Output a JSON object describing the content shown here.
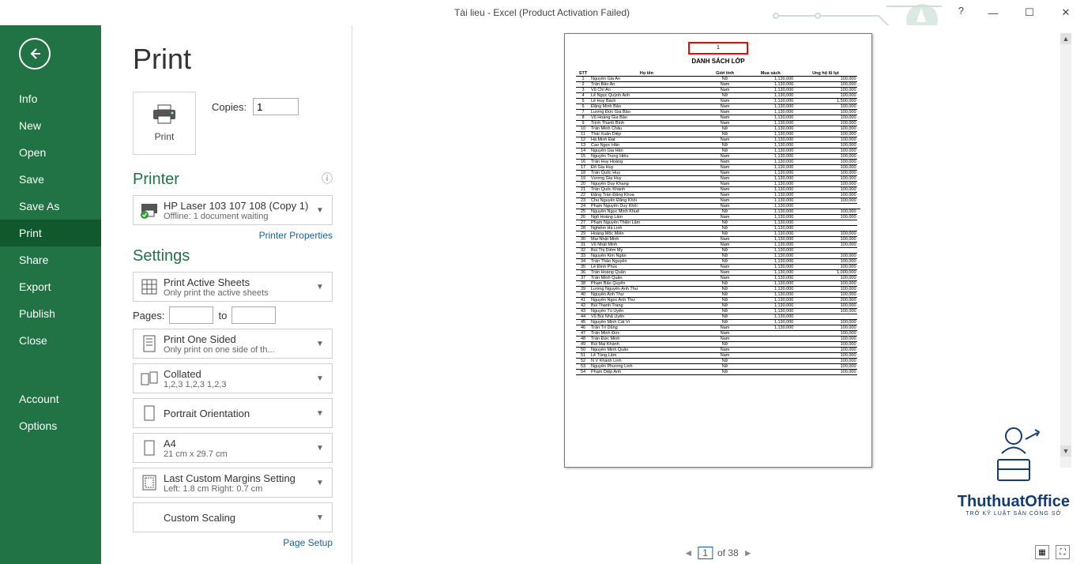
{
  "titlebar": {
    "title": "Tài lieu - Excel (Product Activation Failed)",
    "help": "?"
  },
  "sidebar": {
    "items": [
      "Info",
      "New",
      "Open",
      "Save",
      "Save As",
      "Print",
      "Share",
      "Export",
      "Publish",
      "Close",
      "Account",
      "Options"
    ],
    "selected": "Print"
  },
  "page": {
    "title": "Print",
    "print_button": "Print",
    "copies_label": "Copies:",
    "copies_value": "1"
  },
  "printer": {
    "heading": "Printer",
    "name": "HP Laser 103 107 108 (Copy 1)",
    "status": "Offline: 1 document waiting",
    "properties_link": "Printer Properties"
  },
  "settings": {
    "heading": "Settings",
    "scope": {
      "main": "Print Active Sheets",
      "sub": "Only print the active sheets"
    },
    "pages": {
      "label": "Pages:",
      "to": "to"
    },
    "sides": {
      "main": "Print One Sided",
      "sub": "Only print on one side of th..."
    },
    "collate": {
      "main": "Collated",
      "sub": "1,2,3    1,2,3    1,2,3"
    },
    "orientation": {
      "main": "Portrait Orientation"
    },
    "paper": {
      "main": "A4",
      "sub": "21 cm x 29.7 cm"
    },
    "margins": {
      "main": "Last Custom Margins Setting",
      "sub": "Left:   1.8 cm     Right:   0.7 cm"
    },
    "scaling": {
      "main": "Custom Scaling"
    },
    "page_setup_link": "Page Setup"
  },
  "pager": {
    "current": "1",
    "of": "of 38"
  },
  "preview": {
    "header_number": "1",
    "title": "DANH SÁCH LỚP",
    "columns": [
      "STT",
      "Họ tên",
      "Giới tính",
      "Mua sách",
      "Úng hộ lũ lụt"
    ],
    "rows": [
      [
        "1",
        "Nguyễn Gia An",
        "Nữ",
        "1,130,000",
        "100,000"
      ],
      [
        "2",
        "Trần Bảo An",
        "Nam",
        "1,130,000",
        "100,000"
      ],
      [
        "3",
        "Vũ Chí An",
        "Nam",
        "1,130,000",
        "100,000"
      ],
      [
        "4",
        "Lê Ngọc Quỳnh Anh",
        "Nữ",
        "1,130,000",
        "100,000"
      ],
      [
        "5",
        "Lê Huy Bách",
        "Nam",
        "1,130,000",
        "1,500,000"
      ],
      [
        "6",
        "Đặng Minh Bảo",
        "Nam",
        "1,130,000",
        "100,000"
      ],
      [
        "7",
        "Lương Đức Gia Bảo",
        "Nam",
        "1,130,000",
        "100,000"
      ],
      [
        "8",
        "Vũ Hoàng Gia Bảo",
        "Nam",
        "1,130,000",
        "100,000"
      ],
      [
        "9",
        "Trịnh Thanh Bình",
        "Nam",
        "1,130,000",
        "100,000"
      ],
      [
        "10",
        "Trần Minh Châu",
        "Nữ",
        "1,130,000",
        "100,000"
      ],
      [
        "11",
        "Thái Xuân Diệp",
        "Nữ",
        "1,130,000",
        "100,000"
      ],
      [
        "12",
        "Hà Minh Đạt",
        "Nam",
        "1,130,000",
        "100,000"
      ],
      [
        "13",
        "Cao Ngọc Hân",
        "Nữ",
        "1,130,000",
        "100,000"
      ],
      [
        "14",
        "Nguyễn Gia Hân",
        "Nữ",
        "1,130,000",
        "100,000"
      ],
      [
        "15",
        "Nguyễn Trung Hiếu",
        "Nam",
        "1,130,000",
        "100,000"
      ],
      [
        "16",
        "Trần Huy Hoàng",
        "Nam",
        "1,130,000",
        "100,000"
      ],
      [
        "17",
        "Đỗ Gia Huy",
        "Nam",
        "1,130,000",
        "100,000"
      ],
      [
        "18",
        "Trần Quốc Huy",
        "Nam",
        "1,130,000",
        "100,000"
      ],
      [
        "19",
        "Vương Gia Huy",
        "Nam",
        "1,130,000",
        "100,000"
      ],
      [
        "20",
        "Nguyễn Duy Khang",
        "Nam",
        "1,130,000",
        "100,000"
      ],
      [
        "21",
        "Trần Quốc Khánh",
        "Nam",
        "1,130,000",
        "100,000"
      ],
      [
        "22",
        "Đặng Trần Đăng Khoa",
        "Nam",
        "1,130,000",
        "100,000"
      ],
      [
        "23",
        "Chu Nguyễn Đăng Khôi",
        "Nam",
        "1,130,000",
        "100,000"
      ],
      [
        "24",
        "Phạm Nguyễn Duy Khôi",
        "Nam",
        "1,130,000",
        "",
        ""
      ],
      [
        "25",
        "Nguyễn Ngọc Minh Khuê",
        "Nữ",
        "1,130,000",
        "100,000"
      ],
      [
        "26",
        "Ngô Hoàng Lâm",
        "Nam",
        "1,130,000",
        "100,000"
      ],
      [
        "27",
        "Phạm Nguyễn Thiện Lâm",
        "Nữ",
        "1,130,000",
        ""
      ],
      [
        "28",
        "Nghiêm Hà Linh",
        "Nữ",
        "1,130,000",
        ""
      ],
      [
        "29",
        "Hoàng Mộc Miên",
        "Nữ",
        "1,130,000",
        "100,000"
      ],
      [
        "30",
        "Mai Nhật Minh",
        "Nam",
        "1,130,000",
        "100,000"
      ],
      [
        "31",
        "Vũ Nhật Minh",
        "Nam",
        "1,130,000",
        "100,000"
      ],
      [
        "32",
        "Bùi Thị Diễm My",
        "Nữ",
        "1,130,000",
        ""
      ],
      [
        "33",
        "Nguyễn Kim Ngân",
        "Nữ",
        "1,130,000",
        "100,000"
      ],
      [
        "34",
        "Trần Thảo Nguyên",
        "Nữ",
        "1,130,000",
        "100,000"
      ],
      [
        "35",
        "Lê Đình Phúc",
        "Nam",
        "1,130,000",
        "100,000"
      ],
      [
        "36",
        "Trần Hoàng Quân",
        "Nam",
        "1,130,000",
        "1,000,000"
      ],
      [
        "37",
        "Trần Minh Quân",
        "Nam",
        "1,130,000",
        "100,000"
      ],
      [
        "38",
        "Phạm Bảo Quyên",
        "Nữ",
        "1,130,000",
        "100,000"
      ],
      [
        "39",
        "Lương Nguyễn Anh Thư",
        "Nữ",
        "1,130,000",
        "100,000"
      ],
      [
        "40",
        "Nguyễn Anh Thư",
        "Nữ",
        "1,130,000",
        "100,000"
      ],
      [
        "41",
        "Nguyễn Ngọc Anh Thư",
        "Nữ",
        "1,130,000",
        "200,000"
      ],
      [
        "42",
        "Bùi Thanh Trang",
        "Nữ",
        "1,130,000",
        "100,000"
      ],
      [
        "43",
        "Nguyễn Tú Uyên",
        "Nữ",
        "1,130,000",
        "100,000"
      ],
      [
        "44",
        "Vũ Bùi Nhã Uyên",
        "Nữ",
        "1,130,000",
        ""
      ],
      [
        "45",
        "Nguyễn Minh Cát Vi",
        "Nữ",
        "1,130,000",
        "100,000"
      ],
      [
        "46",
        "Trần Trí Dũng",
        "Nam",
        "1,130,000",
        "100,000"
      ],
      [
        "47",
        "Trần Minh Đức",
        "Nam",
        "",
        "100,000"
      ],
      [
        "48",
        "Trần Đức Minh",
        "Nam",
        "",
        "100,000"
      ],
      [
        "49",
        "Bùi Mai Khánh",
        "Nữ",
        "",
        "100,000"
      ],
      [
        "50",
        "Nguyễn Minh Quân",
        "Nam",
        "",
        "100,000"
      ],
      [
        "51",
        "Lê Tùng Lâm",
        "Nam",
        "",
        "100,000"
      ],
      [
        "52",
        "N V Khánh Linh",
        "Nữ",
        "",
        "100,000"
      ],
      [
        "53",
        "Nguyễn Phương Linh",
        "Nữ",
        "",
        "100,000"
      ],
      [
        "54",
        "Phạm Diệp Anh",
        "Nữ",
        "",
        "100,000"
      ]
    ]
  },
  "watermark": {
    "text": "ThuthuatOffice",
    "sub": "TRỞ KỸ LUẬT SÂN CÔNG SỞ"
  }
}
